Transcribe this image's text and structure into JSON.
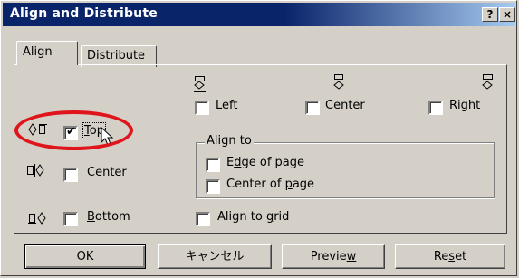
{
  "window": {
    "title": "Align and Distribute",
    "help_label": "?",
    "close_label": "×"
  },
  "tabs": [
    {
      "label": "Align",
      "selected": true
    },
    {
      "label": "Distribute",
      "selected": false
    }
  ],
  "horizontal": {
    "left": {
      "prefix": "",
      "mnemonic": "L",
      "suffix": "eft",
      "checked": false
    },
    "center": {
      "prefix": "",
      "mnemonic": "C",
      "suffix": "enter",
      "checked": false
    },
    "right": {
      "prefix": "",
      "mnemonic": "R",
      "suffix": "ight",
      "checked": false
    }
  },
  "vertical": {
    "top": {
      "prefix": "",
      "mnemonic": "T",
      "suffix": "op",
      "checked": true
    },
    "center": {
      "prefix": "C",
      "mnemonic": "e",
      "suffix": "nter",
      "checked": false
    },
    "bottom": {
      "prefix": "",
      "mnemonic": "B",
      "suffix": "ottom",
      "checked": false
    }
  },
  "align_to": {
    "label": "Align to",
    "edge": {
      "prefix": "E",
      "mnemonic": "d",
      "suffix": "ge of page",
      "checked": false
    },
    "center_page": {
      "prefix": "Center of ",
      "mnemonic": "p",
      "suffix": "age",
      "checked": false
    }
  },
  "align_grid": {
    "prefix": "Align to ",
    "mnemonic": "g",
    "suffix": "rid",
    "checked": false
  },
  "buttons": {
    "ok": "OK",
    "cancel": "キャンセル",
    "preview": {
      "prefix": "Previe",
      "mnemonic": "w",
      "suffix": ""
    },
    "reset": {
      "prefix": "Re",
      "mnemonic": "s",
      "suffix": "et"
    }
  },
  "colors": {
    "titlebar": "#0a246a",
    "highlight_ring": "#e0141b",
    "face": "#d4d0c8"
  },
  "icons": [
    "align-left-icon",
    "align-hcenter-icon",
    "align-right-icon",
    "align-top-icon",
    "align-vcenter-icon",
    "align-bottom-icon",
    "mouse-cursor-icon"
  ]
}
